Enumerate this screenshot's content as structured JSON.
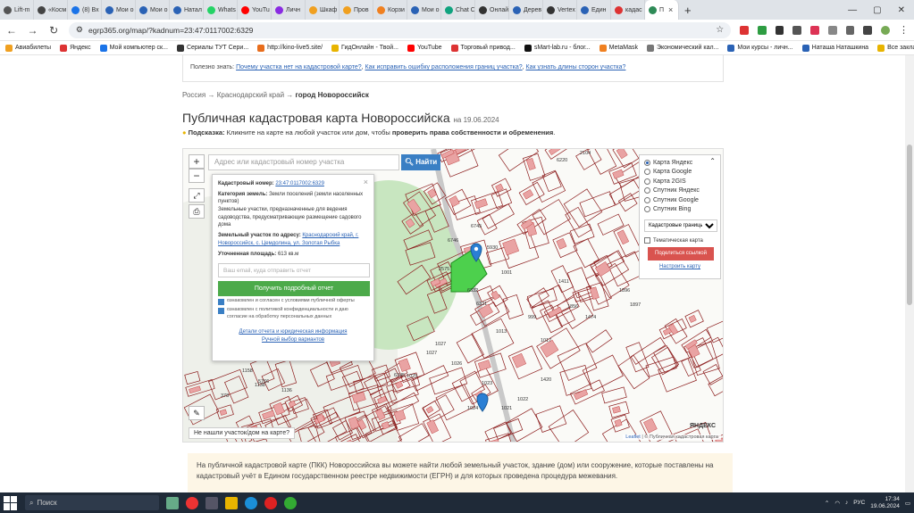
{
  "tabs": [
    {
      "label": "Lift-m",
      "color": "#555"
    },
    {
      "label": "«Косм",
      "color": "#444"
    },
    {
      "label": "(8) Вх",
      "color": "#1a73e8"
    },
    {
      "label": "Мои о",
      "color": "#2a62b5"
    },
    {
      "label": "Мои о",
      "color": "#2a62b5"
    },
    {
      "label": "Натал",
      "color": "#2a62b5"
    },
    {
      "label": "Whats",
      "color": "#25d366"
    },
    {
      "label": "YouTu",
      "color": "#ff0000"
    },
    {
      "label": "Личн",
      "color": "#8a2be2"
    },
    {
      "label": "Шкаф",
      "color": "#f0a020"
    },
    {
      "label": "Пров",
      "color": "#f0a020"
    },
    {
      "label": "Корзи",
      "color": "#f08020"
    },
    {
      "label": "Мои о",
      "color": "#2a62b5"
    },
    {
      "label": "Chat C",
      "color": "#10a37f"
    },
    {
      "label": "Онлай",
      "color": "#333"
    },
    {
      "label": "Дерев",
      "color": "#2a62b5"
    },
    {
      "label": "Vertex",
      "color": "#333"
    },
    {
      "label": "Един",
      "color": "#2a62b5"
    },
    {
      "label": "кадас",
      "color": "#d33"
    },
    {
      "label": "П",
      "color": "#2e8b57"
    }
  ],
  "window_controls": [
    "—",
    "▢",
    "✕"
  ],
  "address": {
    "url": "egrp365.org/map/?kadnum=23:47:0117002:6329"
  },
  "bookmarks": [
    {
      "label": "Авиабилеты",
      "color": "#f0a020"
    },
    {
      "label": "Яндекс",
      "color": "#d33"
    },
    {
      "label": "Мой компьютер ск...",
      "color": "#1a73e8"
    },
    {
      "label": "Сериалы ТУТ Сери...",
      "color": "#333"
    },
    {
      "label": "http://kino-live5.site/",
      "color": "#e86d1c"
    },
    {
      "label": "ГидОнлайн - Твой...",
      "color": "#e8b400"
    },
    {
      "label": "YouTube",
      "color": "#ff0000"
    },
    {
      "label": "Торговый привод...",
      "color": "#d33"
    },
    {
      "label": "sMart-lab.ru - блог...",
      "color": "#111"
    },
    {
      "label": "MetaMask",
      "color": "#f08020"
    },
    {
      "label": "Экономический кал...",
      "color": "#777"
    },
    {
      "label": "Мои курсы - личн...",
      "color": "#2a62b5"
    },
    {
      "label": "Наташа Наташкина",
      "color": "#2a62b5"
    },
    {
      "label": "Все закладки",
      "color": "#e8b400"
    }
  ],
  "useful": {
    "prefix": "Полезно знать:",
    "links": [
      "Почему участка нет на кадастровой карте?",
      "Как исправить ошибку расположения границ участка?",
      "Как узнать длины сторон участка?"
    ]
  },
  "breadcrumb": {
    "a": "Россия",
    "b": "Краснодарский край",
    "c": "город Новороссийск",
    "sep": "→"
  },
  "heading": {
    "title": "Публичная кадастровая карта Новороссийска",
    "date": "на 19.06.2024"
  },
  "hint": {
    "label": "Подсказка:",
    "text": "Кликните на карте на любой участок или дом, чтобы",
    "bold": "проверить права собственности и обременения",
    "end": "."
  },
  "map": {
    "search_placeholder": "Адрес или кадастровый номер участка",
    "find_button": "Найти",
    "zoom_in": "+",
    "zoom_out": "−",
    "not_found": "Не нашли участок/дом на карте?",
    "attribution_leaflet": "Leaflet",
    "attribution_rest": "| © Публичная кадастровая карта",
    "yandex_logo": "ЯНДЕКС",
    "parcel_labels": [
      "5930",
      "6745",
      "6746",
      "1001",
      "6332",
      "6331",
      "2575",
      "999",
      "1013",
      "1017",
      "1027",
      "1026",
      "1025",
      "1023",
      "1024",
      "1021",
      "1022",
      "1420",
      "1474",
      "1411",
      "1856",
      "1896",
      "1897",
      "6220",
      "2104",
      "1158",
      "1138",
      "1136",
      "5766",
      "378",
      "6345",
      "1027"
    ],
    "popup": {
      "close": "×",
      "kad_label": "Кадастровый номер:",
      "kad_value": "23:47:0117002:6329",
      "cat_label": "Категория земель:",
      "cat_value": "Земли поселений (земли населенных пунктов)",
      "use_text": "Земельные участки, предназначенные для ведения садоводства, предусматривающие размещение садового дома",
      "addr_label": "Земельный участок по адресу:",
      "addr_value": "Краснодарский край, г. Новороссийск, с. Цемдолина, ул. Золотая Рыбка",
      "area_label": "Уточненная площадь:",
      "area_value": "613 кв.м",
      "email_placeholder": "Ваш email, куда отправить отчет",
      "report_button": "Получить подробный отчет",
      "check1": "ознакомлен и согласен с условиями публичной оферты",
      "check2": "ознакомлен с политикой конфиденциальности и даю согласие на обработку персональных данных",
      "details_link": "Детали отчета и юридическая информация",
      "manual_link": "Ручной выбор вариантов"
    },
    "layers": {
      "options": [
        "Карта Яндекс",
        "Карта Google",
        "Карта 2GIS",
        "Спутник Яндекс",
        "Спутник Google",
        "Спутник Bing"
      ],
      "selected": 0,
      "select_value": "Кадастровые границы",
      "thematic": "Тематическая карта",
      "share_button": "Поделиться ссылкой",
      "settings_link": "Настроить карту"
    }
  },
  "info": {
    "text": "На публичной кадастровой карте (ПКК) Новороссийска вы можете найти любой земельный участок, здание (дом) или сооружение, которые поставлены на кадастровый учёт в Едином государственном реестре недвижимости (ЕГРН) и для которых проведена процедура межевания."
  },
  "taskbar": {
    "search": "Поиск",
    "lang": "РУС",
    "time": "17:34",
    "date": "19.06.2024"
  }
}
